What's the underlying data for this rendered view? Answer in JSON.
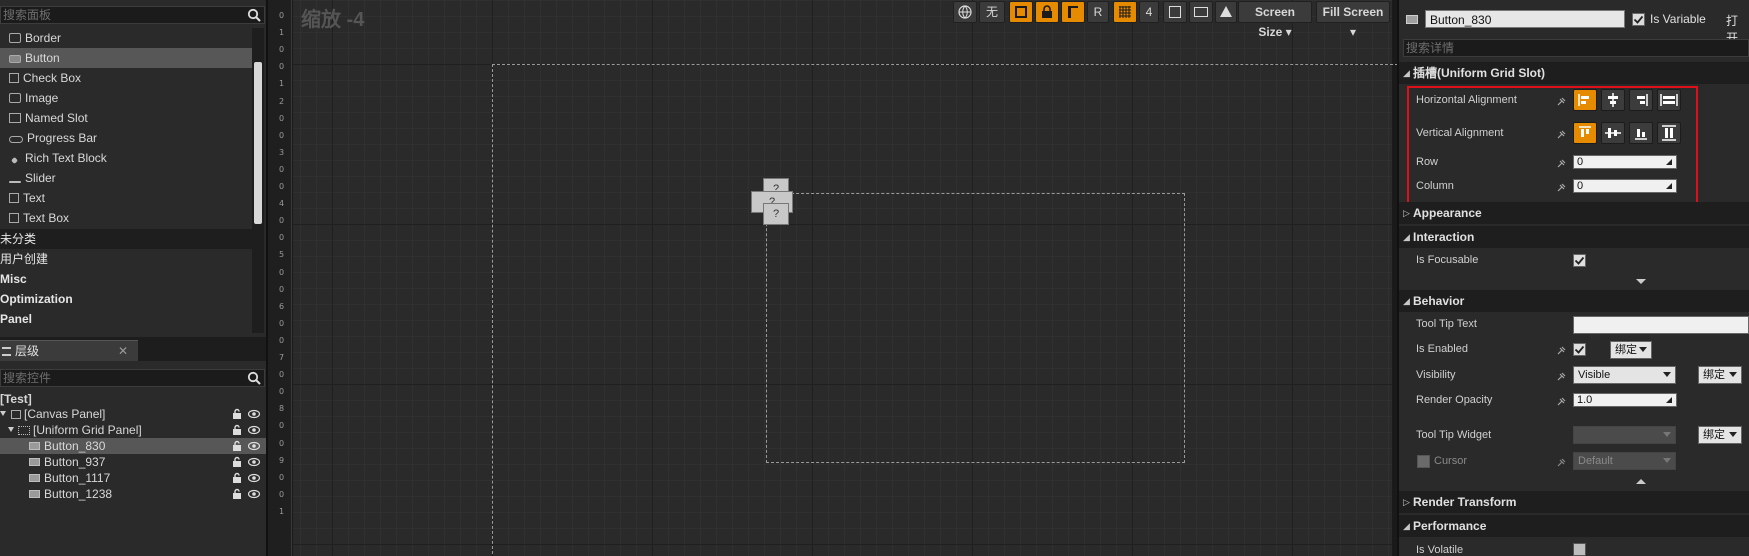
{
  "palette": {
    "search_placeholder": "搜索面板",
    "items": [
      {
        "label": "Border",
        "icon": "border-icon"
      },
      {
        "label": "Button",
        "icon": "button-icon"
      },
      {
        "label": "Check Box",
        "icon": "checkbox-icon"
      },
      {
        "label": "Image",
        "icon": "image-icon"
      },
      {
        "label": "Named Slot",
        "icon": "named-slot-icon"
      },
      {
        "label": "Progress Bar",
        "icon": "progress-bar-icon"
      },
      {
        "label": "Rich Text Block",
        "icon": "rich-text-icon"
      },
      {
        "label": "Slider",
        "icon": "slider-icon"
      },
      {
        "label": "Text",
        "icon": "text-icon"
      },
      {
        "label": "Text Box",
        "icon": "text-box-icon"
      }
    ],
    "categories": [
      "未分类",
      "用户创建",
      "Misc",
      "Optimization",
      "Panel"
    ]
  },
  "hierarchy": {
    "tab_label": "层级",
    "search_placeholder": "搜索控件",
    "root": "[Test]",
    "canvas_panel": "[Canvas Panel]",
    "grid_panel": "[Uniform Grid Panel]",
    "buttons": [
      "Button_830",
      "Button_937",
      "Button_1117",
      "Button_1238"
    ]
  },
  "designer": {
    "zoom_label": "缩放 -4",
    "ruler_numbers": [
      "0",
      "1",
      "0",
      "0",
      "1",
      "2",
      "0",
      "0",
      "3",
      "0",
      "0",
      "4",
      "0",
      "0",
      "5",
      "0",
      "0",
      "6",
      "0",
      "0",
      "7",
      "0",
      "0",
      "8",
      "0",
      "0",
      "9",
      "0",
      "0",
      "1"
    ],
    "toolbar": {
      "none_label": "无",
      "r_label": "R",
      "grid_size": "4",
      "screen_size": "Screen Size",
      "fill_screen": "Fill Screen"
    },
    "placeholder_glyph": "?"
  },
  "details": {
    "name": "Button_830",
    "is_variable_label": "Is Variable",
    "open_label": "打开",
    "search_placeholder": "搜索详情",
    "slot_section": "插槽(Uniform Grid Slot)",
    "horizontal_alignment": "Horizontal Alignment",
    "vertical_alignment": "Vertical Alignment",
    "row_label": "Row",
    "row_value": "0",
    "column_label": "Column",
    "column_value": "0",
    "appearance_section": "Appearance",
    "interaction_section": "Interaction",
    "is_focusable_label": "Is Focusable",
    "behavior_section": "Behavior",
    "tooltip_text_label": "Tool Tip Text",
    "is_enabled_label": "Is Enabled",
    "bind_label": "绑定",
    "visibility_label": "Visibility",
    "visibility_value": "Visible",
    "render_opacity_label": "Render Opacity",
    "render_opacity_value": "1.0",
    "tooltip_widget_label": "Tool Tip Widget",
    "cursor_label": "Cursor",
    "cursor_value": "Default",
    "render_transform_section": "Render Transform",
    "performance_section": "Performance",
    "is_volatile_label": "Is Volatile"
  },
  "colors": {
    "accent": "#e68a00",
    "highlight_box": "#e0101a",
    "selected_row": "#575757"
  }
}
